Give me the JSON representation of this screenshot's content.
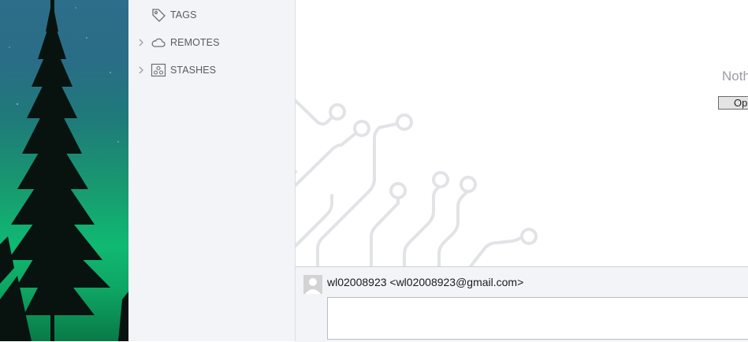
{
  "sidebar": {
    "items": [
      {
        "label": "TAGS",
        "icon": "tag-icon",
        "expandable": false
      },
      {
        "label": "REMOTES",
        "icon": "cloud-icon",
        "expandable": true
      },
      {
        "label": "STASHES",
        "icon": "stash-icon",
        "expandable": true
      }
    ]
  },
  "main": {
    "empty_text": "Noth",
    "open_button_label": "Op"
  },
  "commit": {
    "author": "wl02008923 <wl02008923@gmail.com>",
    "message_value": ""
  },
  "colors": {
    "sidebar_bg": "#f3f4f7",
    "circuit": "#e2e3e6",
    "wallpaper_green": "#10b972"
  }
}
